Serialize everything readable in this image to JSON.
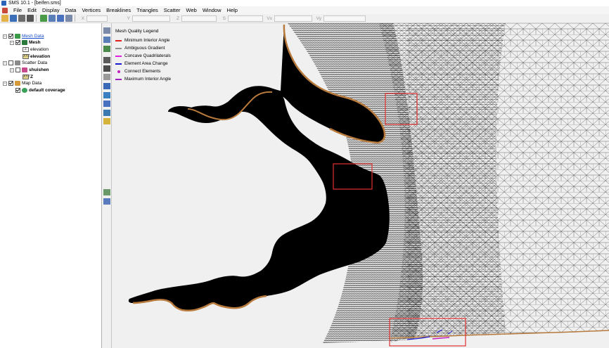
{
  "window": {
    "title": "SMS 10.1 - [beifen.sms]"
  },
  "menu": [
    "File",
    "Edit",
    "Display",
    "Data",
    "Vertices",
    "Breaklines",
    "Triangles",
    "Scatter",
    "Web",
    "Window",
    "Help"
  ],
  "toolbar": {
    "coords": [
      {
        "label": "X",
        "value": ""
      },
      {
        "label": "Y",
        "value": ""
      },
      {
        "label": "Z",
        "value": ""
      },
      {
        "label": "S",
        "value": ""
      },
      {
        "label": "Vx",
        "value": ""
      },
      {
        "label": "Vy",
        "value": ""
      }
    ]
  },
  "explorer": {
    "mesh_data": "Mesh Data",
    "mesh": "Mesh",
    "dataset_elevation": "elevation",
    "dataset_elevation_active": "elevation",
    "scatter_data": "Scatter Data",
    "scatter_name": "shuishen",
    "scatter_dataset": "Z",
    "map_data": "Map Data",
    "coverage": "default coverage",
    "dataset_icon_text_z": "Z",
    "dataset_icon_text_xyz": "XYZ"
  },
  "legend": {
    "title": "Mesh Quality Legend",
    "items": [
      {
        "label": "Minimum Interior Angle",
        "color": "#e02020",
        "kind": "line"
      },
      {
        "label": "Ambiguous Gradient",
        "color": "#909090",
        "kind": "line"
      },
      {
        "label": "Concave Quadrilaterals",
        "color": "#e020e0",
        "kind": "line"
      },
      {
        "label": "Element Area Change",
        "color": "#1a1ad0",
        "kind": "line"
      },
      {
        "label": "Connect Elements",
        "color": "#c020c0",
        "kind": "dot"
      },
      {
        "label": "Maximum Interior Angle",
        "color": "#a020c0",
        "kind": "line"
      }
    ]
  },
  "colors": {
    "mesh_line": "#1a1a1a",
    "dense_mesh": "#050505",
    "boundary": "#b77a3c",
    "highlight_box": "#e03030"
  }
}
